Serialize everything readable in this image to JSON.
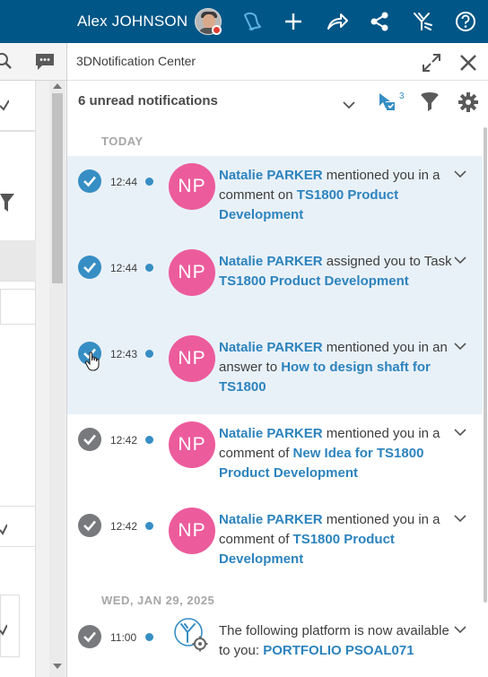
{
  "topbar": {
    "user_name": "Alex JOHNSON",
    "icons": [
      "avatar",
      "notification-bell-icon",
      "add-icon",
      "share-icon",
      "network-icon",
      "compass-icon",
      "help-icon"
    ]
  },
  "notification_center": {
    "title": "3DNotification Center",
    "unread_label": "6 unread notifications",
    "selection_count": "3",
    "groups": [
      {
        "label": "TODAY",
        "items": [
          {
            "time": "12:44",
            "initials": "NP",
            "who": "Natalie PARKER",
            "action": " mentioned you in a comment on ",
            "object": "TS1800 Product Development",
            "unread": true
          },
          {
            "time": "12:44",
            "initials": "NP",
            "who": "Natalie PARKER",
            "action": " assigned you to Task ",
            "object": "TS1800 Product Development",
            "unread": true
          },
          {
            "time": "12:43",
            "initials": "NP",
            "who": "Natalie PARKER",
            "action": " mentioned you in an answer to ",
            "object": "How to design shaft for TS1800",
            "unread": true
          },
          {
            "time": "12:42",
            "initials": "NP",
            "who": "Natalie PARKER",
            "action": " mentioned you in a comment of ",
            "object": "New Idea for TS1800 Product Development",
            "unread": false
          },
          {
            "time": "12:42",
            "initials": "NP",
            "who": "Natalie PARKER",
            "action": " mentioned you in a comment of ",
            "object": "TS1800 Product Development",
            "unread": false
          }
        ]
      },
      {
        "label": "WED, JAN 29, 2025",
        "items": [
          {
            "time": "11:00",
            "prefix": "The following platform is now available to you: ",
            "object": "PORTFOLIO PSOAL071",
            "unread": false
          }
        ]
      }
    ]
  },
  "colors": {
    "topbar": "#005686",
    "accent_blue": "#368ec4",
    "link_blue": "#2c83bd",
    "avatar_pink": "#ec5c9d",
    "unread_bg": "#e9f1f8"
  }
}
